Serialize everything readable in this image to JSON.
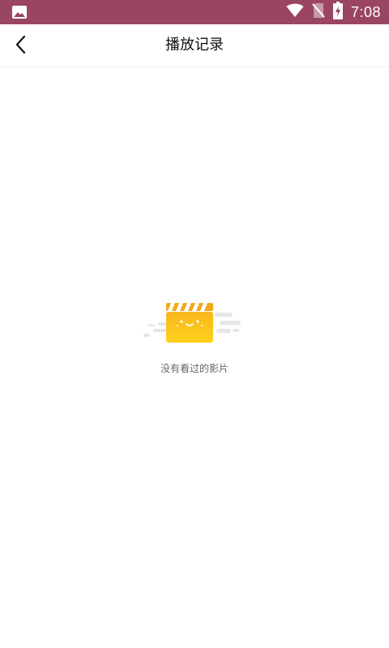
{
  "status_bar": {
    "time": "7:08",
    "background": "#9a4563",
    "icons": [
      "image-icon",
      "wifi-icon",
      "no-sim-icon",
      "battery-charging-icon"
    ]
  },
  "app_bar": {
    "title": "播放记录",
    "back_icon": "chevron-left-icon"
  },
  "empty_state": {
    "message": "没有看过的影片",
    "illustration": "clapperboard-smile-icon",
    "colors": {
      "board_top": "#f7b61d",
      "board_bottom": "#ffd21a",
      "speed_lines": "#e6e6e6"
    }
  }
}
